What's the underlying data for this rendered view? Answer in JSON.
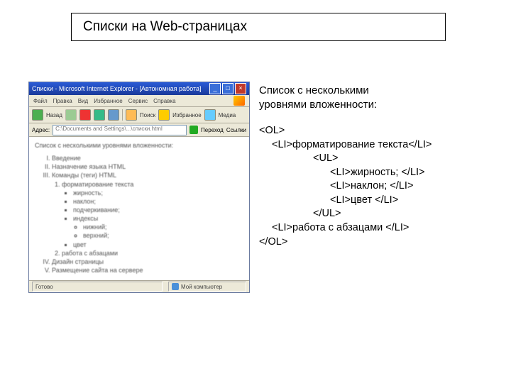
{
  "slide": {
    "title": "Списки на Web-страницах"
  },
  "right": {
    "heading_l1": "Список с несколькими",
    "heading_l2": "уровнями вложенности:",
    "code": {
      "l1": "<OL>",
      "l2": "<LI>форматирование текста</LI>",
      "l3": "<UL>",
      "l4": "<LI>жирность; </LI>",
      "l5": "<LI>наклон; </LI>",
      "l6": "<LI>цвет </LI>",
      "l7": "</UL>",
      "l8": "<LI>работа с абзацами </LI>",
      "l9": "</OL>"
    }
  },
  "browser": {
    "title": "Списки - Microsoft Internet Explorer - [Автономная работа]",
    "menu": {
      "file": "Файл",
      "edit": "Правка",
      "view": "Вид",
      "fav": "Избранное",
      "tools": "Сервис",
      "help": "Справка"
    },
    "toolbar": {
      "back": "Назад",
      "search": "Поиск",
      "favorites": "Избранное",
      "media": "Медиа"
    },
    "addr": {
      "label": "Адрес:",
      "value": "C:\\Documents and Settings\\...\\списки.html",
      "go": "Переход",
      "links": "Ссылки"
    },
    "page": {
      "heading": "Список с несколькими уровнями вложенности:",
      "i1": "Введение",
      "i2": "Назначение языка HTML",
      "i3": "Команды (теги) HTML",
      "i3_1": "форматирование текста",
      "i3_1_a": "жирность;",
      "i3_1_b": "наклон;",
      "i3_1_c": "подчеркивание;",
      "i3_1_d": "индексы",
      "i3_1_d_1": "нижний;",
      "i3_1_d_2": "верхний;",
      "i3_1_e": "цвет",
      "i3_2": "работа с абзацами",
      "i4": "Дизайн страницы",
      "i5": "Размещение сайта на сервере"
    },
    "status": {
      "done": "Готово",
      "zone": "Мой компьютер"
    }
  }
}
